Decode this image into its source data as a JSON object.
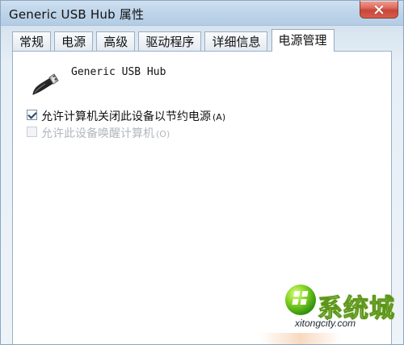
{
  "window": {
    "title": "Generic USB Hub 属性"
  },
  "titlebar": {
    "close_icon": "close-icon"
  },
  "tabs": [
    {
      "label": "常规",
      "active": false
    },
    {
      "label": "电源",
      "active": false
    },
    {
      "label": "高级",
      "active": false
    },
    {
      "label": "驱动程序",
      "active": false
    },
    {
      "label": "详细信息",
      "active": false
    },
    {
      "label": "电源管理",
      "active": true
    }
  ],
  "device": {
    "name": "Generic USB Hub",
    "icon": "usb-icon"
  },
  "options": [
    {
      "label": "允许计算机关闭此设备以节约电源",
      "hotkey": "(A)",
      "checked": true,
      "enabled": true
    },
    {
      "label": "允许此设备唤醒计算机",
      "hotkey": "(O)",
      "checked": false,
      "enabled": false
    }
  ],
  "watermark": {
    "text": "系统城",
    "url": "xitongcity.com",
    "icon": "windows-logo-icon"
  }
}
